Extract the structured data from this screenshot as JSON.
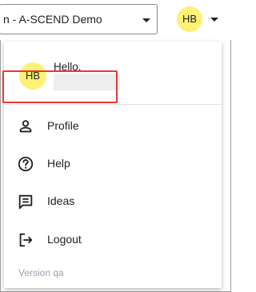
{
  "topbar": {
    "org_select": {
      "value": "n - A-SCEND Demo",
      "icon": "chevron-down-icon"
    },
    "avatar_initials": "HB",
    "avatar_color": "#fff176"
  },
  "menu": {
    "user": {
      "initials": "HB",
      "greeting": "Hello,"
    },
    "items": [
      {
        "label": "Profile",
        "icon": "person-icon",
        "highlighted": true
      },
      {
        "label": "Help",
        "icon": "help-circle-icon"
      },
      {
        "label": "Ideas",
        "icon": "feedback-icon"
      },
      {
        "label": "Logout",
        "icon": "logout-icon"
      }
    ],
    "version": "Version qa",
    "highlight_color": "#e53935"
  }
}
